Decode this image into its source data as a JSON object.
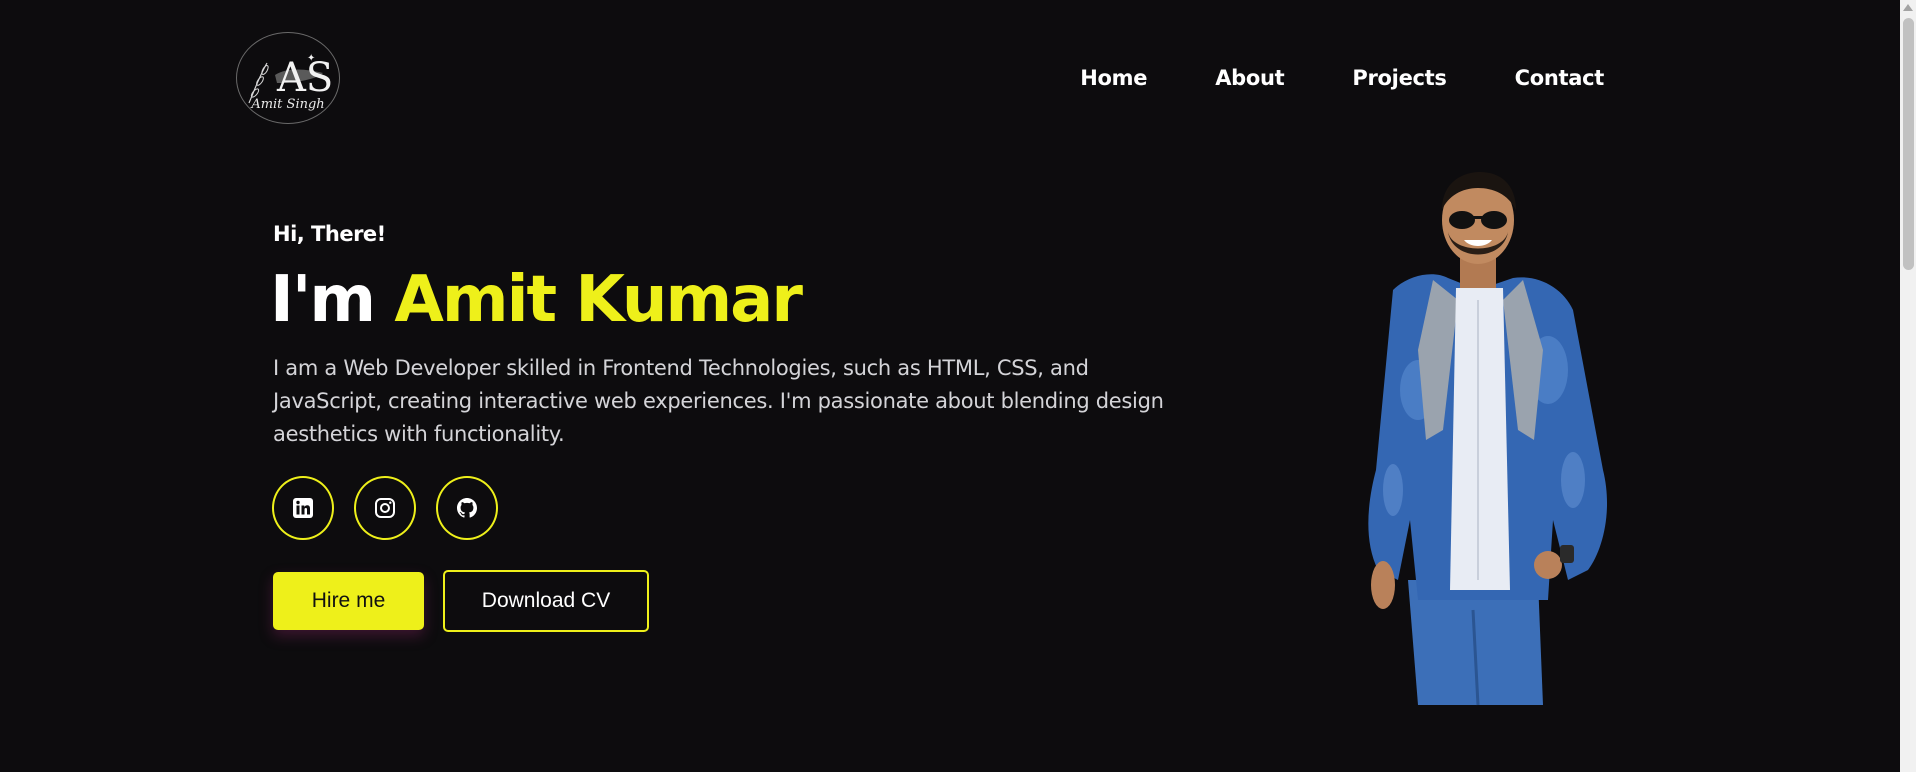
{
  "logo": {
    "monogram": "AS",
    "signature": "Amit Singh"
  },
  "nav": {
    "items": [
      {
        "label": "Home"
      },
      {
        "label": "About"
      },
      {
        "label": "Projects"
      },
      {
        "label": "Contact"
      }
    ]
  },
  "hero": {
    "greeting": "Hi, There!",
    "headline_prefix": "I'm",
    "headline_name": "Amit Kumar",
    "description": "I am a Web Developer skilled in Frontend Technologies, such as HTML, CSS, and JavaScript, creating interactive web experiences. I'm passionate about blending design aesthetics with functionality.",
    "socials": [
      {
        "icon": "linkedin-icon"
      },
      {
        "icon": "instagram-icon"
      },
      {
        "icon": "github-icon"
      }
    ],
    "hire_label": "Hire me",
    "cv_label": "Download CV"
  },
  "colors": {
    "background": "#0d0c0e",
    "accent": "#eef01a",
    "text": "#ffffff",
    "muted_text": "#d4d4d8"
  }
}
